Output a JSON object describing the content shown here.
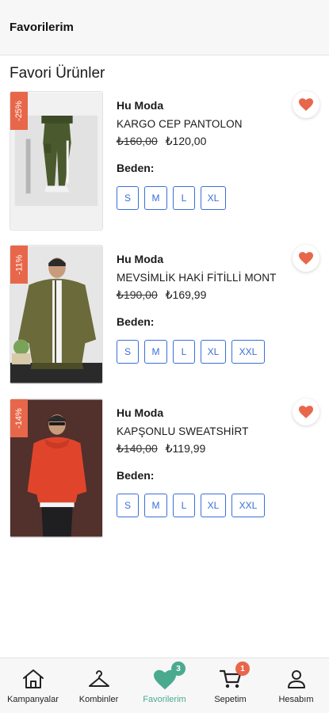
{
  "header": {
    "title": "Favorilerim"
  },
  "section_title": "Favori Ürünler",
  "size_label": "Beden:",
  "products": [
    {
      "discount": "-25%",
      "brand": "Hu Moda",
      "name": "KARGO CEP PANTOLON",
      "old_price": "₺160,00",
      "new_price": "₺120,00",
      "sizes": [
        "S",
        "M",
        "L",
        "XL"
      ]
    },
    {
      "discount": "-11%",
      "brand": "Hu Moda",
      "name": "MEVSİMLİK HAKİ  FİTİLLİ MONT",
      "old_price": "₺190,00",
      "new_price": "₺169,99",
      "sizes": [
        "S",
        "M",
        "L",
        "XL",
        "XXL"
      ]
    },
    {
      "discount": "-14%",
      "brand": "Hu Moda",
      "name": "KAPŞONLU SWEATSHİRT",
      "old_price": "₺140,00",
      "new_price": "₺119,99",
      "sizes": [
        "S",
        "M",
        "L",
        "XL",
        "XXL"
      ]
    }
  ],
  "nav": {
    "items": [
      {
        "label": "Kampanyalar",
        "icon": "home-icon"
      },
      {
        "label": "Kombinler",
        "icon": "hanger-icon"
      },
      {
        "label": "Favorilerim",
        "icon": "heart-icon",
        "badge": "3"
      },
      {
        "label": "Sepetim",
        "icon": "cart-icon",
        "badge": "1"
      },
      {
        "label": "Hesabım",
        "icon": "user-icon"
      }
    ]
  },
  "colors": {
    "accent_green": "#4aaa8e",
    "discount_red": "#e8674a",
    "size_blue": "#3b6fd8",
    "heart_red": "#e8674a"
  }
}
